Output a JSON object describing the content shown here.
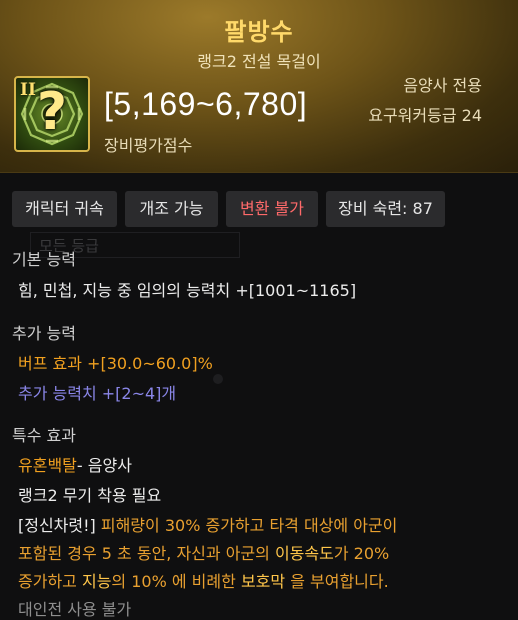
{
  "item": {
    "name": "팔방수",
    "subtitle": "랭크2 전설 목걸이",
    "rank_badge": "II",
    "icon_glyph": "?",
    "icon": "trigram-amulet-icon",
    "score": "[5,169~6,780]",
    "score_label": "장비평가점수",
    "class_only": "음양사 전용",
    "req_level": "요구워커등급 24"
  },
  "tags": [
    {
      "label": "캐릭터 귀속",
      "color": "#e6e6e6"
    },
    {
      "label": "개조 가능",
      "color": "#e6e6e6"
    },
    {
      "label": "변환 불가",
      "color": "#ff6a6a"
    },
    {
      "label": "장비 숙련: 87",
      "color": "#e6e6e6"
    }
  ],
  "ghost_select": "모든 등급",
  "basic": {
    "heading": "기본 능력",
    "line": "힘, 민첩, 지능 중 임의의 능력치 +[1001~1165]"
  },
  "extra": {
    "heading": "추가 능력",
    "buff": "버프 효과  +[30.0~60.0]%",
    "stat": "추가 능력치 +[2~4]개"
  },
  "special": {
    "heading": "특수 효과",
    "skill": "유혼백탈",
    "skill_suffix": "- 음양사",
    "requirement": "랭크2 무기 착용 필요",
    "desc": {
      "tag": "[정신차렷!]",
      "l1": " 피해량이 30% 증가하고 타격 대상에 아군이",
      "l2a": "포함된 경우 5 초 동안, 자신과 아군의 ",
      "l2b": "이동속도",
      "l2c": "가 20%",
      "l3a": "증가하고 ",
      "l3b": "지능",
      "l3c": "의 10% 에 비례한 ",
      "l3d": "보호막",
      "l3e": " 을 부여합니다."
    },
    "pvp": "대인전 사용 불가"
  },
  "colors": {
    "title": "#ffd96a",
    "orange": "#f0a020",
    "purple": "#8a86e8",
    "highlight": "#ffc64a",
    "red": "#ff6a6a"
  }
}
